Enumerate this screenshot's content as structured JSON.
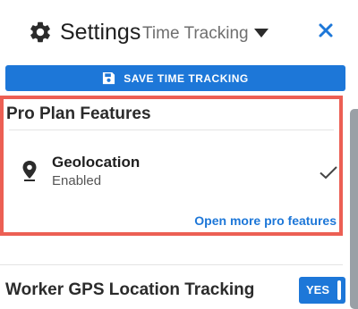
{
  "header": {
    "title": "Settings",
    "subtitle": "Time Tracking",
    "icons": {
      "settings": "gear-icon",
      "dropdown": "caret-down-icon",
      "close": "close-icon"
    },
    "close_color": "#1d77d8"
  },
  "save_button": {
    "label": "SAVE TIME TRACKING",
    "icon": "floppy-disk-icon",
    "color": "#1d77d8"
  },
  "pro_plan": {
    "title": "Pro Plan Features",
    "highlight_color": "#ec5f54",
    "feature": {
      "name": "Geolocation",
      "status": "Enabled",
      "icon": "location-pin-icon",
      "checked": true
    },
    "more_link": "Open more pro features"
  },
  "gps_tracking": {
    "label": "Worker GPS Location Tracking",
    "toggle": "YES",
    "enabled": true
  }
}
